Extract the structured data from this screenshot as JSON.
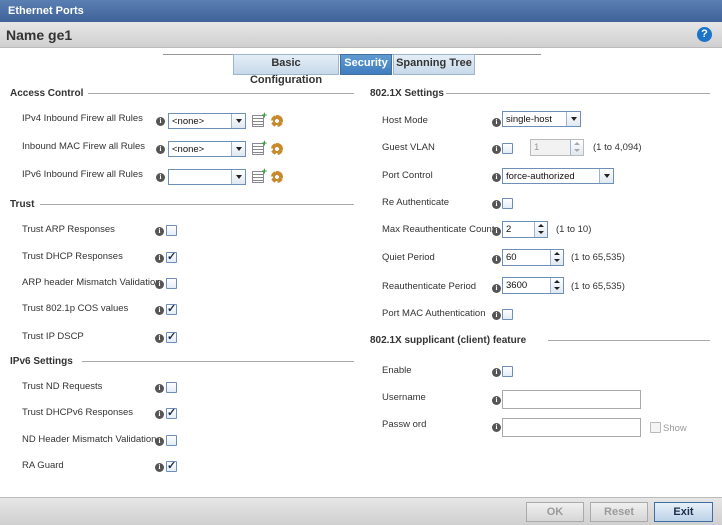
{
  "window": {
    "title": "Ethernet Ports"
  },
  "header": {
    "name_label": "Name",
    "name_value": "ge1"
  },
  "tabs": [
    {
      "label": "Basic Configuration",
      "active": false
    },
    {
      "label": "Security",
      "active": true
    },
    {
      "label": "Spanning Tree",
      "active": false
    }
  ],
  "access_control": {
    "title": "Access Control",
    "ipv4_label": "IPv4 Inbound Firew all Rules",
    "ipv4_value": "<none>",
    "mac_label": "Inbound MAC Firew all Rules",
    "mac_value": "<none>",
    "ipv6_label": "IPv6 Inbound Firew all Rules",
    "ipv6_value": ""
  },
  "trust": {
    "title": "Trust",
    "arp_label": "Trust ARP Responses",
    "arp_checked": false,
    "dhcp_label": "Trust DHCP Responses",
    "dhcp_checked": true,
    "arp_mismatch_label": "ARP header Mismatch Validation",
    "arp_mismatch_checked": false,
    "cos_label": "Trust 802.1p COS values",
    "cos_checked": true,
    "dscp_label": "Trust IP DSCP",
    "dscp_checked": true
  },
  "ipv6": {
    "title": "IPv6 Settings",
    "nd_label": "Trust ND Requests",
    "nd_checked": false,
    "dhcpv6_label": "Trust DHCPv6 Responses",
    "dhcpv6_checked": true,
    "nd_mismatch_label": "ND Header Mismatch Validation",
    "nd_mismatch_checked": false,
    "ra_label": "RA Guard",
    "ra_checked": true
  },
  "dot1x": {
    "title": "802.1X Settings",
    "host_mode_label": "Host Mode",
    "host_mode_value": "single-host",
    "guest_vlan_label": "Guest VLAN",
    "guest_vlan_checked": false,
    "guest_vlan_value": "1",
    "guest_vlan_range": "(1 to 4,094)",
    "port_control_label": "Port Control",
    "port_control_value": "force-authorized",
    "reauth_label": "Re Authenticate",
    "reauth_checked": false,
    "max_reauth_label": "Max Reauthenticate Count",
    "max_reauth_value": "2",
    "max_reauth_range": "(1 to 10)",
    "quiet_label": "Quiet Period",
    "quiet_value": "60",
    "quiet_range": "(1 to 65,535)",
    "reauth_period_label": "Reauthenticate Period",
    "reauth_period_value": "3600",
    "reauth_period_range": "(1 to 65,535)",
    "port_mac_label": "Port MAC Authentication",
    "port_mac_checked": false
  },
  "supplicant": {
    "title": "802.1X supplicant (client) feature",
    "enable_label": "Enable",
    "enable_checked": false,
    "username_label": "Username",
    "username_value": "",
    "password_label": "Passw ord",
    "password_value": "",
    "show_label": "Show"
  },
  "footer": {
    "ok_label": "OK",
    "reset_label": "Reset",
    "exit_label": "Exit"
  },
  "colors": {
    "titlebar": "#4a6fa5",
    "tab_active": "#4a88c8",
    "help": "#1b74c7"
  }
}
